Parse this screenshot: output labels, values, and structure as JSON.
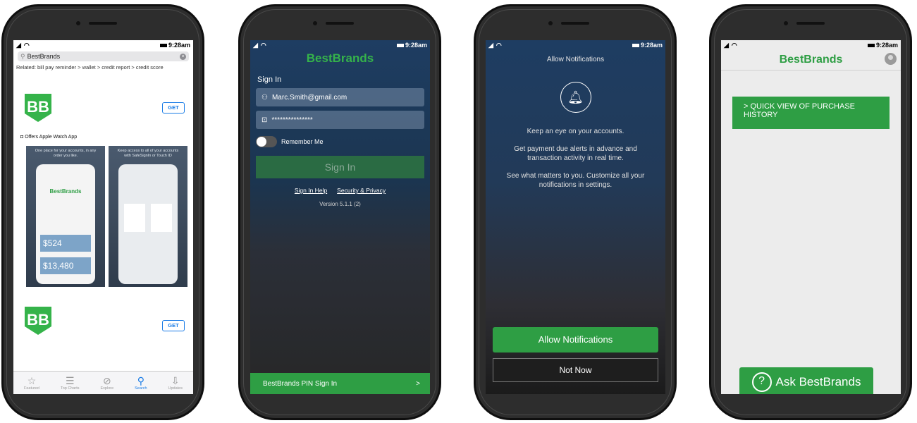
{
  "status": {
    "time": "9:28am"
  },
  "appstore": {
    "search_value": "BestBrands",
    "related": "Related:  bill pay reminder >   wallet >   credit report >   credit score",
    "get_label": "GET",
    "watch_text": "Offers Apple Watch App",
    "shot1_caption": "One place for your accounts, in any order you like.",
    "shot2_caption": "Keep access to all of your accounts with SafeSignIn or Touch ID",
    "shot_brand": "BestBrands",
    "tabs": [
      {
        "label": "Featured",
        "icon": "star-icon",
        "glyph": "☆"
      },
      {
        "label": "Top Charts",
        "icon": "list-icon",
        "glyph": "☰"
      },
      {
        "label": "Explore",
        "icon": "compass-icon",
        "glyph": "⊘"
      },
      {
        "label": "Search",
        "icon": "search-icon",
        "glyph": "⚲"
      },
      {
        "label": "Updates",
        "icon": "updates-icon",
        "glyph": "⇩"
      }
    ],
    "accent": "#1a7ce6"
  },
  "signin": {
    "brand": "BestBrands",
    "label": "Sign In",
    "email": "Marc.Smith@gmail.com",
    "password": "***************",
    "remember": "Remember Me",
    "button": "Sign In",
    "help": "Sign In Help",
    "security": "Security & Privacy",
    "version": "Version 5.1.1 (2)",
    "pin": "BestBrands PIN Sign In",
    "pin_chevron": ">"
  },
  "notifications": {
    "title": "Allow Notifications",
    "line1": "Keep an eye on your accounts.",
    "line2": "Get payment due alerts in advance and transaction activity in real time.",
    "line3": "See what matters to you. Customize all your notifications in settings.",
    "allow": "Allow Notifications",
    "not_now": "Not Now"
  },
  "home": {
    "brand": "BestBrands",
    "quick_view": "> QUICK VIEW OF PURCHASE HISTORY",
    "ask": "Ask BestBrands",
    "ask_glyph": "?"
  },
  "colors": {
    "brand_green": "#2e9e44",
    "navy": "#1e3d62"
  }
}
